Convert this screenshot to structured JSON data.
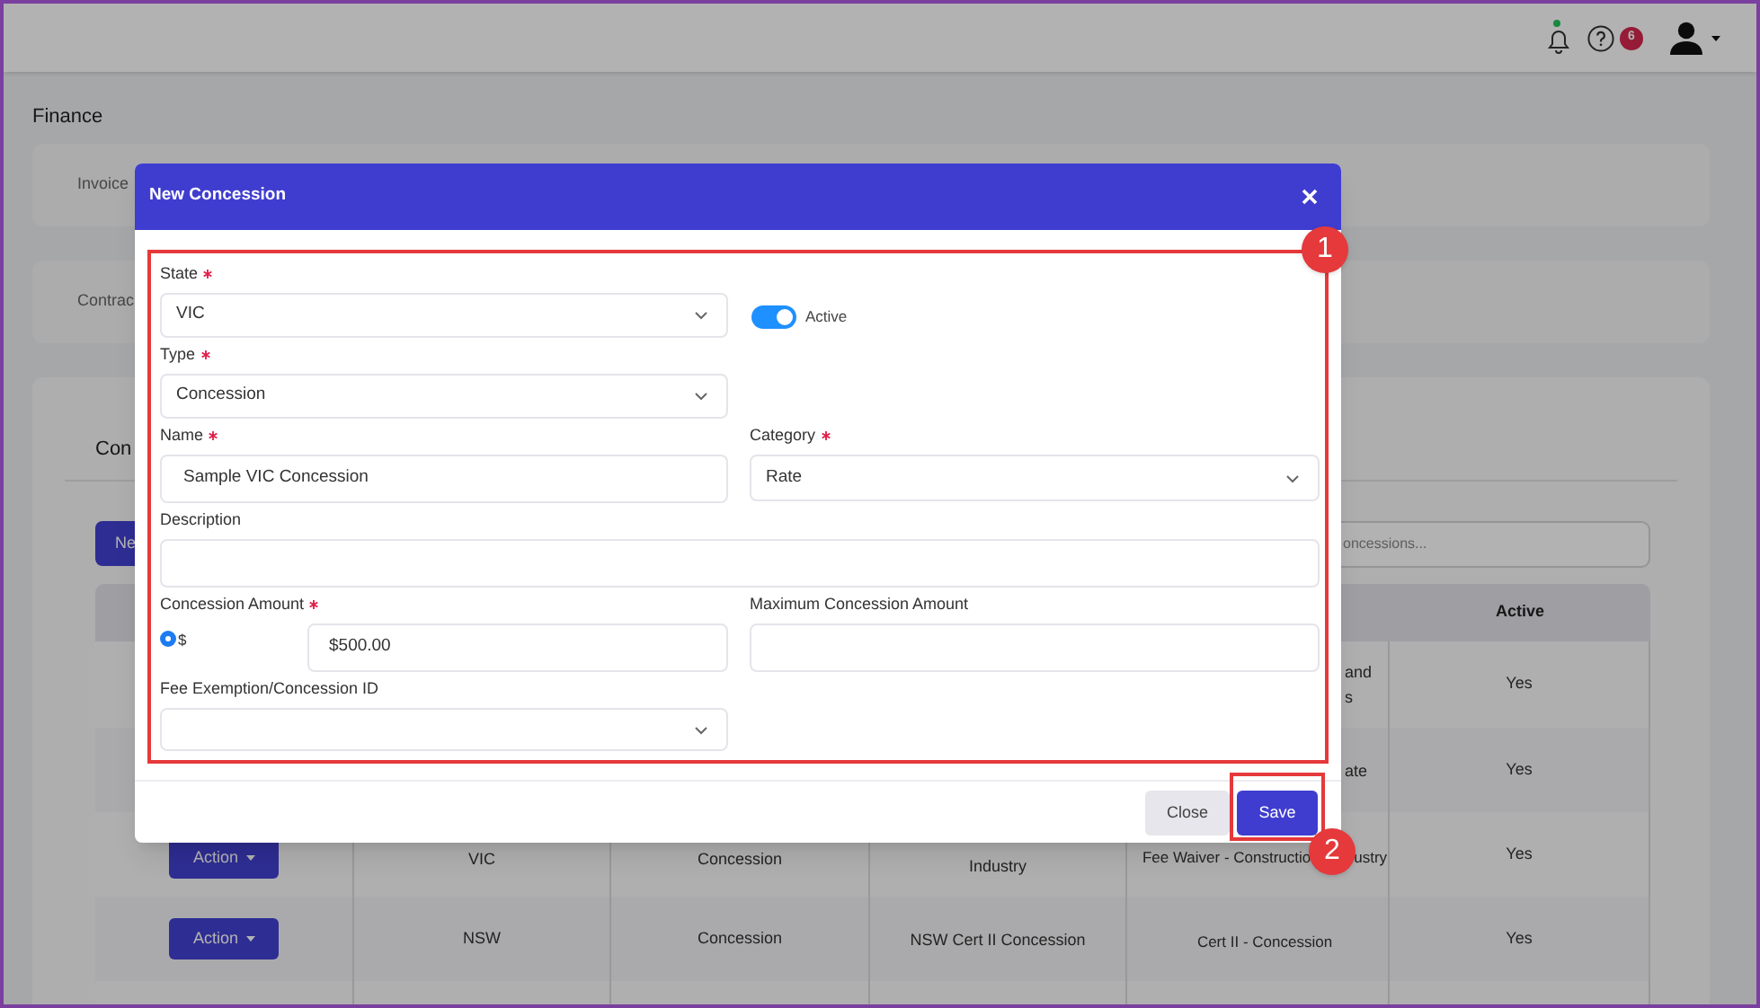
{
  "topbar": {
    "notification_dot": true,
    "help_badge": "6"
  },
  "page_title": "Finance",
  "cards": [
    {
      "label": "Invoice"
    },
    {
      "label": "Contrac"
    }
  ],
  "section": {
    "title": "Con",
    "new_button": "Ne",
    "search": {
      "placeholder": "oncessions..."
    },
    "table": {
      "active_header": "Active",
      "rows": [
        {
          "column_5": [
            "and",
            "s"
          ],
          "active": "Yes"
        },
        {
          "column_5": [
            "ate"
          ],
          "active": "Yes"
        },
        {
          "action": "Action",
          "column_2": "VIC",
          "column_3": "Concession",
          "column_4": [
            "Industry"
          ],
          "column_5": [
            "Fee Waiver - Constructio",
            "ustry"
          ],
          "active": "Yes"
        },
        {
          "action": "Action",
          "column_2": "NSW",
          "column_3": "Concession",
          "column_4": [
            "NSW Cert II Concession"
          ],
          "column_5": [
            "Cert II - Concession"
          ],
          "active": "Yes"
        }
      ]
    }
  },
  "modal": {
    "title": "New Concession",
    "state": {
      "label": "State",
      "required": true,
      "value": "VIC"
    },
    "active_toggle": {
      "label": "Active",
      "on": true
    },
    "type": {
      "label": "Type",
      "required": true,
      "value": "Concession"
    },
    "name": {
      "label": "Name",
      "required": true,
      "value": "Sample VIC Concession"
    },
    "category": {
      "label": "Category",
      "required": true,
      "value": "Rate"
    },
    "description": {
      "label": "Description",
      "required": false
    },
    "concession_amount": {
      "label": "Concession Amount",
      "required": true,
      "radio": {
        "label": "$",
        "selected": true
      },
      "value": "$500.00"
    },
    "maximum_amount": {
      "label": "Maximum Concession Amount",
      "required": false
    },
    "fee_exemption": {
      "label": "Fee Exemption/Concession ID",
      "required": false
    },
    "buttons": [
      {
        "label": "Close",
        "kind": "secondary"
      },
      {
        "label": "Save",
        "kind": "primary"
      }
    ]
  },
  "annotations": [
    {
      "number": "1"
    },
    {
      "number": "2"
    }
  ]
}
